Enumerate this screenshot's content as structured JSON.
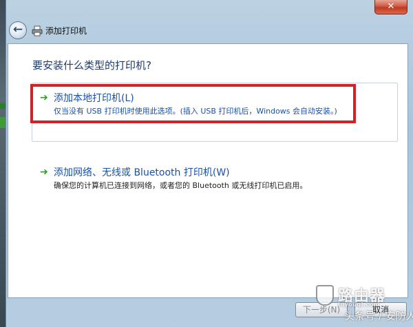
{
  "window": {
    "title": "添加打印机",
    "close_glyph": "✕"
  },
  "nav": {
    "back_icon": "back-arrow-icon",
    "back_glyph": "←"
  },
  "content": {
    "question": "要安装什么类型的打印机?",
    "options": [
      {
        "arrow_glyph": "➔",
        "title": "添加本地打印机(L)",
        "description": "仅当没有 USB 打印机时使用此选项。(插入 USB 打印机后，Windows 会自动安装。)"
      },
      {
        "arrow_glyph": "➔",
        "title": "添加网络、无线或 Bluetooth 打印机(W)",
        "description": "确保您的计算机已连接到网络，或者您的 Bluetooth 或无线打印机已启用。"
      }
    ]
  },
  "footer": {
    "next_label": "下一步(N)",
    "cancel_label": "取消"
  },
  "watermark": {
    "brand": "路由器",
    "brand_sub": "luyouqi.com",
    "line": "头条号 / 安防人"
  },
  "colors": {
    "highlight_border": "#d32226",
    "link_blue": "#1a50a8",
    "arrow_green": "#23a020"
  }
}
